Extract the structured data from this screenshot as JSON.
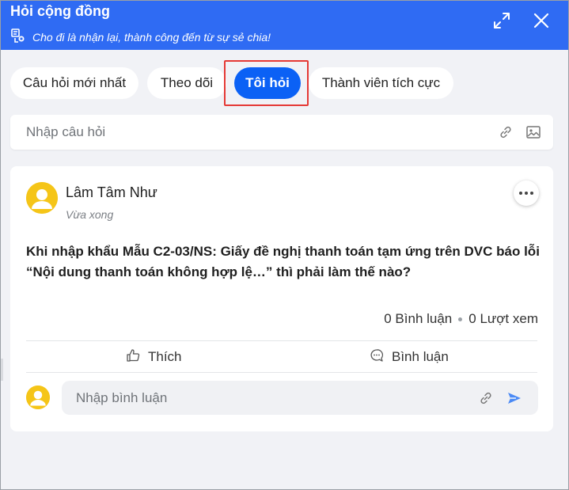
{
  "header": {
    "title": "Hỏi cộng đồng",
    "subtitle": "Cho đi là nhận lại, thành công đến từ sự sẻ chia!",
    "accent_color": "#2f6bf3",
    "expand_icon": "expand-icon",
    "close_icon": "close-icon"
  },
  "tabs": [
    {
      "label": "Câu hỏi mới nhất",
      "active": false
    },
    {
      "label": "Theo dõi",
      "active": false
    },
    {
      "label": "Tôi hỏi",
      "active": true
    },
    {
      "label": "Thành viên tích cực",
      "active": false
    }
  ],
  "question_input": {
    "placeholder": "Nhập câu hỏi",
    "attach_icon": "link-icon",
    "image_icon": "image-icon"
  },
  "post": {
    "author": "Lâm Tâm Như",
    "time": "Vừa xong",
    "question": "Khi nhập khẩu Mẫu C2-03/NS: Giấy đề nghị thanh toán tạm ứng trên DVC báo lỗi “Nội dung thanh toán không hợp lệ…” thì phải làm thế nào?",
    "comments_count": "0 Bình luận",
    "views_count": "0 Lượt xem",
    "like_label": "Thích",
    "comment_label": "Bình luận",
    "comment_placeholder": "Nhập bình luận"
  }
}
